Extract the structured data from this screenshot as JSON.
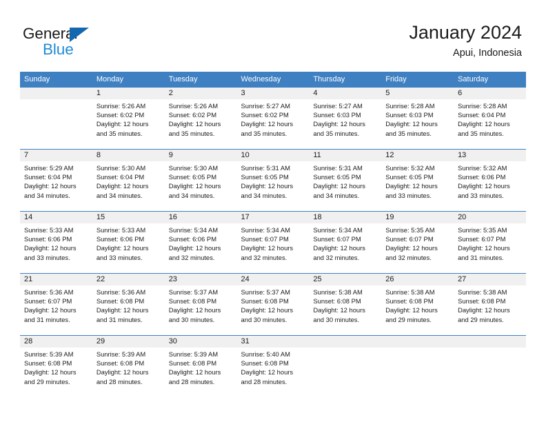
{
  "brand": {
    "name_part1": "General",
    "name_part2": "Blue",
    "triangle_icon": "triangle-icon",
    "color_dark": "#1a1a1a",
    "color_blue": "#1e8bd6",
    "color_triangle": "#1468b0"
  },
  "header": {
    "title": "January 2024",
    "subtitle": "Apui, Indonesia"
  },
  "colors": {
    "header_row_bg": "#3f80c2",
    "day_band_bg": "#f0f0f0",
    "text": "#1a1a1a"
  },
  "weekday_headers": [
    "Sunday",
    "Monday",
    "Tuesday",
    "Wednesday",
    "Thursday",
    "Friday",
    "Saturday"
  ],
  "weeks": [
    [
      {
        "day": "",
        "sunrise": "",
        "sunset": "",
        "daylight1": "",
        "daylight2": "",
        "blank": true
      },
      {
        "day": "1",
        "sunrise": "Sunrise: 5:26 AM",
        "sunset": "Sunset: 6:02 PM",
        "daylight1": "Daylight: 12 hours",
        "daylight2": "and 35 minutes."
      },
      {
        "day": "2",
        "sunrise": "Sunrise: 5:26 AM",
        "sunset": "Sunset: 6:02 PM",
        "daylight1": "Daylight: 12 hours",
        "daylight2": "and 35 minutes."
      },
      {
        "day": "3",
        "sunrise": "Sunrise: 5:27 AM",
        "sunset": "Sunset: 6:02 PM",
        "daylight1": "Daylight: 12 hours",
        "daylight2": "and 35 minutes."
      },
      {
        "day": "4",
        "sunrise": "Sunrise: 5:27 AM",
        "sunset": "Sunset: 6:03 PM",
        "daylight1": "Daylight: 12 hours",
        "daylight2": "and 35 minutes."
      },
      {
        "day": "5",
        "sunrise": "Sunrise: 5:28 AM",
        "sunset": "Sunset: 6:03 PM",
        "daylight1": "Daylight: 12 hours",
        "daylight2": "and 35 minutes."
      },
      {
        "day": "6",
        "sunrise": "Sunrise: 5:28 AM",
        "sunset": "Sunset: 6:04 PM",
        "daylight1": "Daylight: 12 hours",
        "daylight2": "and 35 minutes."
      }
    ],
    [
      {
        "day": "7",
        "sunrise": "Sunrise: 5:29 AM",
        "sunset": "Sunset: 6:04 PM",
        "daylight1": "Daylight: 12 hours",
        "daylight2": "and 34 minutes."
      },
      {
        "day": "8",
        "sunrise": "Sunrise: 5:30 AM",
        "sunset": "Sunset: 6:04 PM",
        "daylight1": "Daylight: 12 hours",
        "daylight2": "and 34 minutes."
      },
      {
        "day": "9",
        "sunrise": "Sunrise: 5:30 AM",
        "sunset": "Sunset: 6:05 PM",
        "daylight1": "Daylight: 12 hours",
        "daylight2": "and 34 minutes."
      },
      {
        "day": "10",
        "sunrise": "Sunrise: 5:31 AM",
        "sunset": "Sunset: 6:05 PM",
        "daylight1": "Daylight: 12 hours",
        "daylight2": "and 34 minutes."
      },
      {
        "day": "11",
        "sunrise": "Sunrise: 5:31 AM",
        "sunset": "Sunset: 6:05 PM",
        "daylight1": "Daylight: 12 hours",
        "daylight2": "and 34 minutes."
      },
      {
        "day": "12",
        "sunrise": "Sunrise: 5:32 AM",
        "sunset": "Sunset: 6:05 PM",
        "daylight1": "Daylight: 12 hours",
        "daylight2": "and 33 minutes."
      },
      {
        "day": "13",
        "sunrise": "Sunrise: 5:32 AM",
        "sunset": "Sunset: 6:06 PM",
        "daylight1": "Daylight: 12 hours",
        "daylight2": "and 33 minutes."
      }
    ],
    [
      {
        "day": "14",
        "sunrise": "Sunrise: 5:33 AM",
        "sunset": "Sunset: 6:06 PM",
        "daylight1": "Daylight: 12 hours",
        "daylight2": "and 33 minutes."
      },
      {
        "day": "15",
        "sunrise": "Sunrise: 5:33 AM",
        "sunset": "Sunset: 6:06 PM",
        "daylight1": "Daylight: 12 hours",
        "daylight2": "and 33 minutes."
      },
      {
        "day": "16",
        "sunrise": "Sunrise: 5:34 AM",
        "sunset": "Sunset: 6:06 PM",
        "daylight1": "Daylight: 12 hours",
        "daylight2": "and 32 minutes."
      },
      {
        "day": "17",
        "sunrise": "Sunrise: 5:34 AM",
        "sunset": "Sunset: 6:07 PM",
        "daylight1": "Daylight: 12 hours",
        "daylight2": "and 32 minutes."
      },
      {
        "day": "18",
        "sunrise": "Sunrise: 5:34 AM",
        "sunset": "Sunset: 6:07 PM",
        "daylight1": "Daylight: 12 hours",
        "daylight2": "and 32 minutes."
      },
      {
        "day": "19",
        "sunrise": "Sunrise: 5:35 AM",
        "sunset": "Sunset: 6:07 PM",
        "daylight1": "Daylight: 12 hours",
        "daylight2": "and 32 minutes."
      },
      {
        "day": "20",
        "sunrise": "Sunrise: 5:35 AM",
        "sunset": "Sunset: 6:07 PM",
        "daylight1": "Daylight: 12 hours",
        "daylight2": "and 31 minutes."
      }
    ],
    [
      {
        "day": "21",
        "sunrise": "Sunrise: 5:36 AM",
        "sunset": "Sunset: 6:07 PM",
        "daylight1": "Daylight: 12 hours",
        "daylight2": "and 31 minutes."
      },
      {
        "day": "22",
        "sunrise": "Sunrise: 5:36 AM",
        "sunset": "Sunset: 6:08 PM",
        "daylight1": "Daylight: 12 hours",
        "daylight2": "and 31 minutes."
      },
      {
        "day": "23",
        "sunrise": "Sunrise: 5:37 AM",
        "sunset": "Sunset: 6:08 PM",
        "daylight1": "Daylight: 12 hours",
        "daylight2": "and 30 minutes."
      },
      {
        "day": "24",
        "sunrise": "Sunrise: 5:37 AM",
        "sunset": "Sunset: 6:08 PM",
        "daylight1": "Daylight: 12 hours",
        "daylight2": "and 30 minutes."
      },
      {
        "day": "25",
        "sunrise": "Sunrise: 5:38 AM",
        "sunset": "Sunset: 6:08 PM",
        "daylight1": "Daylight: 12 hours",
        "daylight2": "and 30 minutes."
      },
      {
        "day": "26",
        "sunrise": "Sunrise: 5:38 AM",
        "sunset": "Sunset: 6:08 PM",
        "daylight1": "Daylight: 12 hours",
        "daylight2": "and 29 minutes."
      },
      {
        "day": "27",
        "sunrise": "Sunrise: 5:38 AM",
        "sunset": "Sunset: 6:08 PM",
        "daylight1": "Daylight: 12 hours",
        "daylight2": "and 29 minutes."
      }
    ],
    [
      {
        "day": "28",
        "sunrise": "Sunrise: 5:39 AM",
        "sunset": "Sunset: 6:08 PM",
        "daylight1": "Daylight: 12 hours",
        "daylight2": "and 29 minutes."
      },
      {
        "day": "29",
        "sunrise": "Sunrise: 5:39 AM",
        "sunset": "Sunset: 6:08 PM",
        "daylight1": "Daylight: 12 hours",
        "daylight2": "and 28 minutes."
      },
      {
        "day": "30",
        "sunrise": "Sunrise: 5:39 AM",
        "sunset": "Sunset: 6:08 PM",
        "daylight1": "Daylight: 12 hours",
        "daylight2": "and 28 minutes."
      },
      {
        "day": "31",
        "sunrise": "Sunrise: 5:40 AM",
        "sunset": "Sunset: 6:08 PM",
        "daylight1": "Daylight: 12 hours",
        "daylight2": "and 28 minutes."
      },
      {
        "day": "",
        "sunrise": "",
        "sunset": "",
        "daylight1": "",
        "daylight2": "",
        "blank": true
      },
      {
        "day": "",
        "sunrise": "",
        "sunset": "",
        "daylight1": "",
        "daylight2": "",
        "blank": true
      },
      {
        "day": "",
        "sunrise": "",
        "sunset": "",
        "daylight1": "",
        "daylight2": "",
        "blank": true
      }
    ]
  ]
}
